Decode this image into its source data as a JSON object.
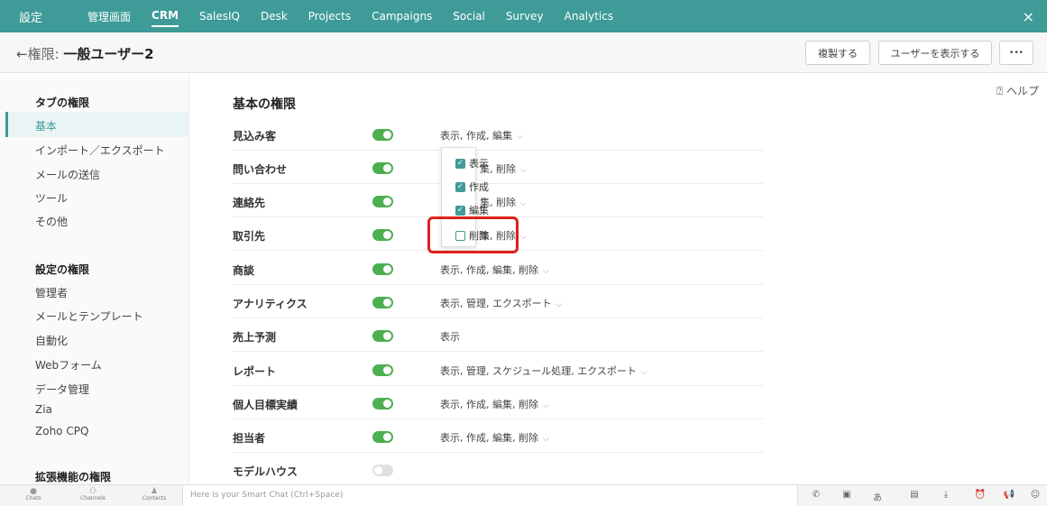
{
  "topnav": {
    "brand": "設定",
    "items": [
      "管理画面",
      "CRM",
      "SalesIQ",
      "Desk",
      "Projects",
      "Campaigns",
      "Social",
      "Survey",
      "Analytics"
    ],
    "active": "CRM",
    "close": "×"
  },
  "header": {
    "back_arrow": "←",
    "title_prefix": "権限: ",
    "title_main": "一般ユーザー2",
    "buttons": {
      "duplicate": "複製する",
      "show_users": "ユーザーを表示する",
      "more": "•••"
    }
  },
  "sidebar": {
    "tab_header": "タブの権限",
    "tab_items": [
      "基本",
      "インポート／エクスポート",
      "メールの送信",
      "ツール",
      "その他"
    ],
    "settings_header": "設定の権限",
    "settings_items": [
      "管理者",
      "メールとテンプレート",
      "自動化",
      "Webフォーム",
      "データ管理",
      "Zia",
      "Zoho CPQ"
    ],
    "ext_header": "拡張機能の権限"
  },
  "main": {
    "title": "基本の権限",
    "help": "ヘルプ",
    "rows": [
      {
        "label": "見込み客",
        "enabled": true,
        "perm": "表示, 作成, 編集",
        "chevron": "⌵"
      },
      {
        "label": "問い合わせ",
        "enabled": true,
        "perm": "集, 削除",
        "chevron": "⌵"
      },
      {
        "label": "連絡先",
        "enabled": true,
        "perm": "集, 削除",
        "chevron": "⌵"
      },
      {
        "label": "取引先",
        "enabled": true,
        "perm": "集, 削除",
        "chevron": "⌵"
      },
      {
        "label": "商談",
        "enabled": true,
        "perm": "表示, 作成, 編集, 削除",
        "chevron": "⌵"
      },
      {
        "label": "アナリティクス",
        "enabled": true,
        "perm": "表示, 管理, エクスポート",
        "chevron": "⌵"
      },
      {
        "label": "売上予測",
        "enabled": true,
        "perm": "表示",
        "chevron": ""
      },
      {
        "label": "レポート",
        "enabled": true,
        "perm": "表示, 管理, スケジュール処理, エクスポート",
        "chevron": "⌵"
      },
      {
        "label": "個人目標実績",
        "enabled": true,
        "perm": "表示, 作成, 編集, 削除",
        "chevron": "⌵"
      },
      {
        "label": "担当者",
        "enabled": true,
        "perm": "表示, 作成, 編集, 削除",
        "chevron": "⌵"
      },
      {
        "label": "モデルハウス",
        "enabled": false,
        "perm": "",
        "chevron": ""
      }
    ]
  },
  "dropdown": {
    "options": [
      {
        "label": "表示",
        "checked": true
      },
      {
        "label": "作成",
        "checked": true
      },
      {
        "label": "編集",
        "checked": true
      },
      {
        "label": "削除",
        "checked": false
      }
    ]
  },
  "bottombar": {
    "tabs": [
      "Chats",
      "Channels",
      "Contacts"
    ],
    "chat_placeholder": "Here is your Smart Chat (Ctrl+Space)"
  },
  "colors": {
    "accent": "#3e9b98",
    "toggle_on": "#4caf50",
    "highlight": "#e0201c"
  }
}
